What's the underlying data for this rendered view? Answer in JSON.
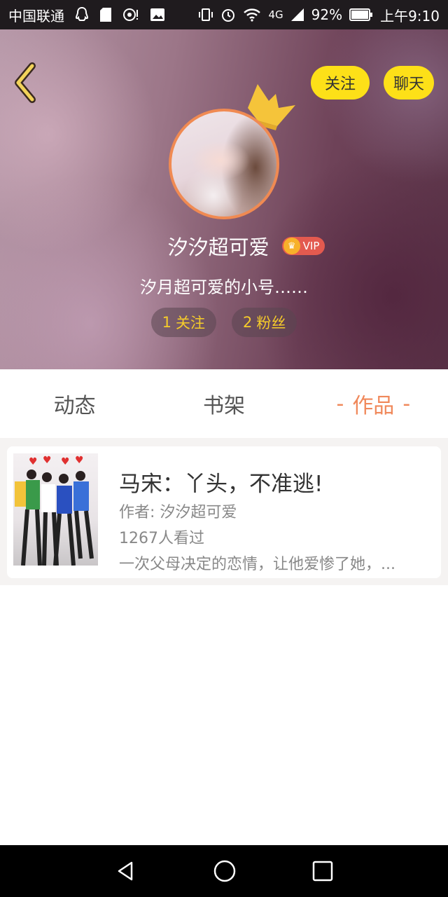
{
  "status_bar": {
    "carrier": "中国联通",
    "network": "4G",
    "battery": "92%",
    "time": "上午9:10"
  },
  "header": {
    "follow_label": "关注",
    "chat_label": "聊天",
    "username": "汐汐超可爱",
    "vip_label": "VIP",
    "bio": "汐月超可爱的小号……",
    "following_count": "1",
    "following_label": "关注",
    "fans_count": "2",
    "fans_label": "粉丝"
  },
  "tabs": [
    {
      "label": "动态"
    },
    {
      "label": "书架"
    },
    {
      "label": "作品"
    }
  ],
  "works": [
    {
      "title": "马宋：丫头，不准逃!",
      "author": "作者: 汐汐超可爱",
      "views": "1267人看过",
      "description": "一次父母决定的恋情，让他爱惨了她，..."
    }
  ],
  "colors": {
    "accent_yellow": "#fde018",
    "active_tab": "#f0885a",
    "stat_text": "#f6cc2a",
    "avatar_border": "#f08a52"
  }
}
